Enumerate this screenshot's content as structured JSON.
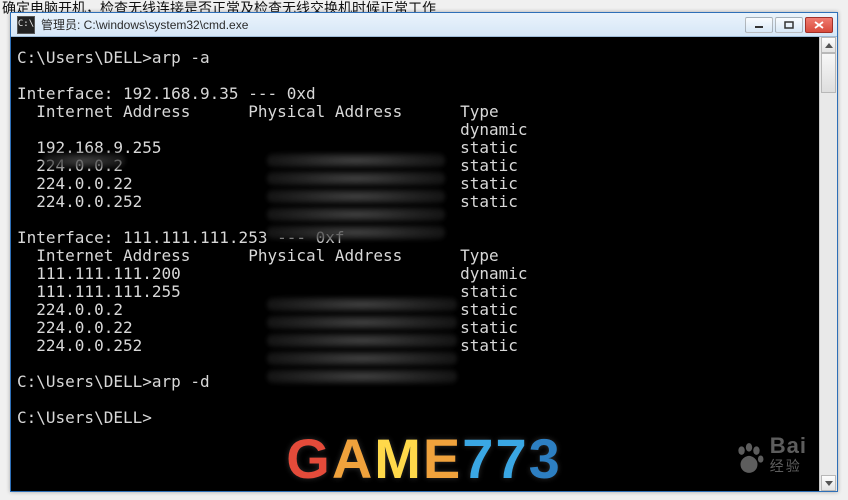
{
  "backdrop_text": "确定电脑开机，检查无线连接是否正常及检查无线交换机时候正常工作",
  "window": {
    "title": "管理员: C:\\windows\\system32\\cmd.exe"
  },
  "cmd": {
    "prompt1": "C:\\Users\\DELL>",
    "command1": "arp -a",
    "interface1_header": "Interface: 192.168.9.35 --- 0xd",
    "col_internet": "Internet Address",
    "col_physical": "Physical Address",
    "col_type": "Type",
    "if1_rows": [
      {
        "ip": "",
        "type": "dynamic"
      },
      {
        "ip": "192.168.9.255",
        "type": "static"
      },
      {
        "ip": "224.0.0.2",
        "type": "static"
      },
      {
        "ip": "224.0.0.22",
        "type": "static"
      },
      {
        "ip": "224.0.0.252",
        "type": "static"
      }
    ],
    "interface2_header": "Interface: 111.111.111.253 --- 0xf",
    "if2_rows": [
      {
        "ip": "111.111.111.200",
        "type": "dynamic"
      },
      {
        "ip": "111.111.111.255",
        "type": "static"
      },
      {
        "ip": "224.0.0.2",
        "type": "static"
      },
      {
        "ip": "224.0.0.22",
        "type": "static"
      },
      {
        "ip": "224.0.0.252",
        "type": "static"
      }
    ],
    "prompt2": "C:\\Users\\DELL>",
    "command2": "arp -d",
    "prompt3": "C:\\Users\\DELL>"
  },
  "watermarks": {
    "baidu_main": "Bai",
    "baidu_sub": "经验",
    "game": [
      "G",
      "A",
      "M",
      "E",
      "7",
      "7",
      "3"
    ]
  }
}
